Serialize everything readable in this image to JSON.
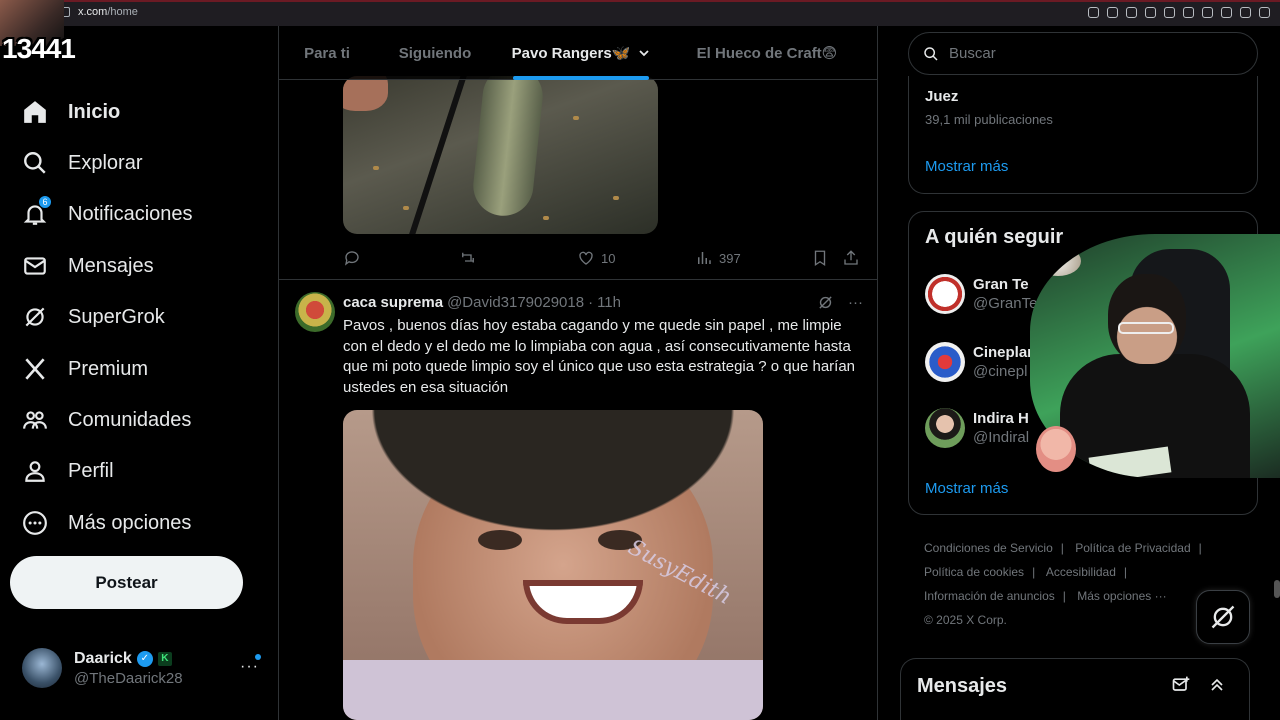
{
  "browser": {
    "url": "x.com/home",
    "url_host": "x.com",
    "url_path": "/home"
  },
  "overlay": {
    "counter": "13441"
  },
  "sidebar": {
    "items": [
      {
        "label": "Inicio",
        "icon": "home-icon",
        "active": true
      },
      {
        "label": "Explorar",
        "icon": "search-icon"
      },
      {
        "label": "Notificaciones",
        "icon": "bell-icon",
        "badge": "6"
      },
      {
        "label": "Mensajes",
        "icon": "mail-icon"
      },
      {
        "label": "SuperGrok",
        "icon": "grok-icon"
      },
      {
        "label": "Premium",
        "icon": "x-logo-icon"
      },
      {
        "label": "Comunidades",
        "icon": "people-icon"
      },
      {
        "label": "Perfil",
        "icon": "person-icon"
      },
      {
        "label": "Más opciones",
        "icon": "more-circle-icon"
      }
    ],
    "post_button": "Postear",
    "account": {
      "name": "Daarick",
      "badge": "K",
      "handle": "@TheDaarick28",
      "more": "···"
    }
  },
  "tabs": [
    {
      "label": "Para ti"
    },
    {
      "label": "Siguiendo"
    },
    {
      "label": "Pavo Rangers🦋",
      "active": true
    },
    {
      "label": "El Hueco de Craft😨"
    }
  ],
  "tweet1": {
    "actions": {
      "reply": "",
      "retweet": "",
      "likes": "10",
      "views": "397"
    }
  },
  "tweet2": {
    "name": "caca suprema",
    "handle": "@David3179029018",
    "separator": "·",
    "time": "11h",
    "more": "···",
    "text": "Pavos , buenos días hoy estaba cagando y me quede sin papel , me limpie con el dedo y  el dedo me lo limpiaba con agua , así consecutivamente hasta que mi poto quede limpio soy el único que uso esta estrategia ? o que harían ustedes en esa situación",
    "image_watermark": "SusyEdith"
  },
  "right": {
    "search_placeholder": "Buscar",
    "trend": {
      "name": "Juez",
      "count": "39,1 mil publicaciones",
      "show_more": "Mostrar más"
    },
    "who_to_follow": {
      "title": "A quién seguir",
      "items": [
        {
          "name": "Gran Te",
          "handle": "@GranTe"
        },
        {
          "name": "Cineplan",
          "handle": "@cinepl"
        },
        {
          "name": "Indira H",
          "handle": "@Indiral"
        }
      ],
      "show_more": "Mostrar más"
    },
    "footer": {
      "links": [
        "Condiciones de Servicio",
        "Política de Privacidad",
        "Política de cookies",
        "Accesibilidad",
        "Información de anuncios",
        "Más opciones ···"
      ],
      "copyright": "© 2025 X Corp."
    },
    "messages": {
      "title": "Mensajes"
    }
  },
  "colors": {
    "accent": "#1d9bf0",
    "background": "#000000",
    "text": "#e7e9ea",
    "muted": "#71767b",
    "border": "#2f3336"
  }
}
